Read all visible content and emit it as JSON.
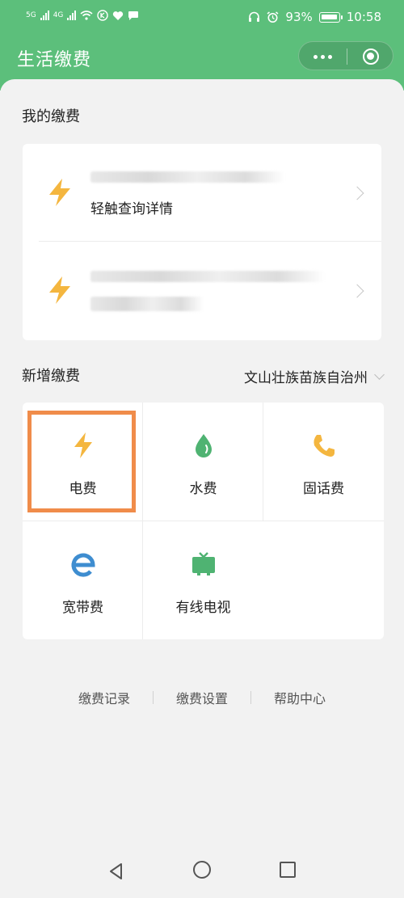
{
  "status_bar": {
    "net_labels": [
      "5G",
      "4G"
    ],
    "battery_percent": "93%",
    "time": "10:58",
    "icons": [
      "signal-icon",
      "wifi-icon",
      "k-icon",
      "heart-icon",
      "chat-icon",
      "headphones-icon",
      "alarm-icon",
      "battery-icon"
    ]
  },
  "header": {
    "title": "生活缴费",
    "more_icon": "more-dots-icon",
    "close_icon": "close-circle-icon"
  },
  "my_bills": {
    "title": "我的缴费",
    "items": [
      {
        "icon": "lightning-icon",
        "label": "轻触查询详情"
      },
      {
        "icon": "lightning-icon",
        "label": ""
      }
    ]
  },
  "new_bill": {
    "title": "新增缴费",
    "region": "文山壮族苗族自治州",
    "services": [
      {
        "icon": "lightning-icon",
        "label": "电费",
        "color": "#f4b63f"
      },
      {
        "icon": "water-drop-icon",
        "label": "水费",
        "color": "#4fb372"
      },
      {
        "icon": "phone-icon",
        "label": "固话费",
        "color": "#f4b63f"
      },
      {
        "icon": "broadband-e-icon",
        "label": "宽带费",
        "color": "#3e8dd0"
      },
      {
        "icon": "tv-icon",
        "label": "有线电视",
        "color": "#4fb372"
      }
    ]
  },
  "footer": {
    "links": [
      "缴费记录",
      "缴费设置",
      "帮助中心"
    ]
  },
  "colors": {
    "header_green": "#5cbf7b",
    "highlight_orange": "#f08c4a",
    "bolt_yellow": "#f4b63f"
  }
}
